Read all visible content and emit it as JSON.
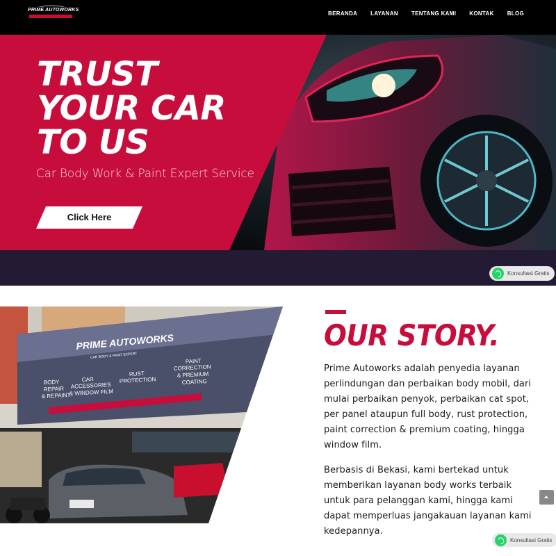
{
  "brand": {
    "logo_text": "PRIME AUTOWORKS"
  },
  "nav": {
    "items": [
      {
        "label": "BERANDA"
      },
      {
        "label": "LAYANAN"
      },
      {
        "label": "TENTANG KAMI"
      },
      {
        "label": "KONTAK"
      },
      {
        "label": "BLOG"
      }
    ]
  },
  "hero": {
    "title_line1": "TRUST",
    "title_line2": "YOUR CAR",
    "title_line3": "TO US",
    "subtitle": "Car Body Work & Paint Expert Service",
    "cta_label": "Click Here"
  },
  "whatsapp": {
    "label": "Konsultasi Gratis"
  },
  "storefront_sign": {
    "brand": "PRIME AUTOWORKS",
    "tagline": "CAR BODY & PAINT EXPERT",
    "services": [
      "BODY REPAIR & REPAINT",
      "CAR ACCESSORIES & WINDOW FILM",
      "RUST PROTECTION",
      "PAINT CORRECTION & PREMIUM COATING"
    ]
  },
  "story": {
    "heading": "OUR STORY.",
    "paragraph1": "Prime Autoworks adalah penyedia layanan perlindungan dan perbaikan body mobil, dari mulai perbaikan penyok, perbaikan cat spot, per panel ataupun full body, rust protection, paint correction & premium coating, hingga window film.",
    "paragraph2": "Berbasis di Bekasi, kami bertekad untuk memberikan layanan body works terbaik untuk para pelanggan kami, hingga kami dapat memperluas jangakauan layanan kami kedepannya."
  },
  "colors": {
    "brand_red": "#c70d3b",
    "nav_bg": "#000000",
    "band_bg": "#231a33",
    "whatsapp_green": "#25d366"
  },
  "icons": [
    "whatsapp-icon",
    "chevron-up-icon"
  ]
}
